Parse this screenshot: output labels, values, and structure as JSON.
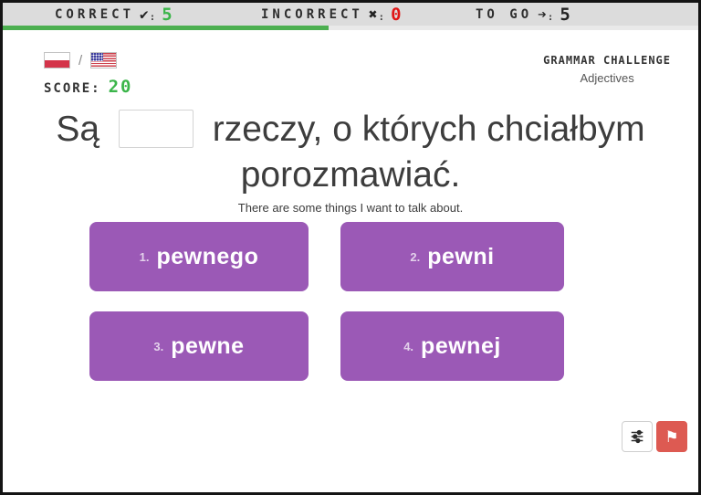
{
  "topbar": {
    "correct_label": "CORRECT",
    "correct_value": "5",
    "incorrect_label": "INCORRECT",
    "incorrect_value": "0",
    "togo_label": "TO GO",
    "togo_value": "5",
    "colon": ":"
  },
  "icons": {
    "check_icon": "✔",
    "x_icon": "✖",
    "arrow_icon": "➔",
    "flag_icon": "⚑",
    "language_separator": "/"
  },
  "progress": {
    "fill_width": "46.8%",
    "description": "5 of 10 answered"
  },
  "header": {
    "score_label": "SCORE:",
    "score_value": "20",
    "source_language": "Polish",
    "target_language": "English (US)",
    "title": "GRAMMAR CHALLENGE",
    "subtitle": "Adjectives"
  },
  "question": {
    "before_blank": "Są",
    "after_blank": "rzeczy, o których chciałbym porozmawiać.",
    "blank_value": "",
    "translation": "There are some things I want to talk about."
  },
  "answers": [
    {
      "number": "1.",
      "text": "pewnego"
    },
    {
      "number": "2.",
      "text": "pewni"
    },
    {
      "number": "3.",
      "text": "pewne"
    },
    {
      "number": "4.",
      "text": "pewnej"
    }
  ],
  "colors": {
    "topbar_bg": "#dcdcdc",
    "progress_green": "#4caf50",
    "correct_green": "#3bb54a",
    "incorrect_red": "#e01515",
    "answer_purple": "#9b59b6",
    "flag_button_red": "#dd5a52",
    "question_text": "#3d3d3d"
  }
}
